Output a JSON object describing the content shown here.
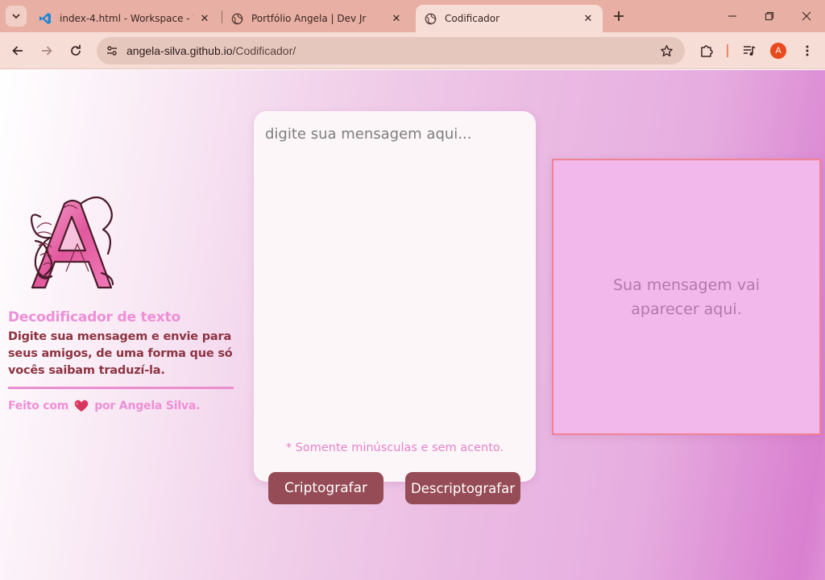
{
  "browser": {
    "tabs": [
      {
        "title": "index-4.html - Workspace - Visual Studio Code",
        "icon": "vscode-icon",
        "active": false
      },
      {
        "title": "Portfólio Angela | Dev Jr",
        "icon": "globe-icon",
        "active": false
      },
      {
        "title": "Codificador",
        "icon": "globe-icon",
        "active": true
      }
    ],
    "url_host": "angela-silva.github.io",
    "url_path": "/Codificador/",
    "profile_initial": "A",
    "colors": {
      "tabbar": "#e8b0a4",
      "toolbar": "#f6ddd6",
      "profile": "#e8491d"
    }
  },
  "page": {
    "brand": {
      "title": "Decodificador de texto",
      "description": "Digite sua mensagem e envie para seus amigos, de uma forma que só vocês saibam traduzí-la.",
      "footer_prefix": "Feito com",
      "footer_suffix": "por Angela Silva."
    },
    "input": {
      "placeholder": "digite sua mensagem aqui...",
      "hint": "* Somente minúsculas e sem acento."
    },
    "buttons": {
      "encrypt": "Criptografar",
      "decrypt": "Descriptografar"
    },
    "output": {
      "placeholder": "Sua mensagem vai aparecer aqui."
    },
    "colors": {
      "accent_pink": "#ee8fd5",
      "dark_rose": "#8d3442",
      "button": "#964c56",
      "output_bg": "#f3b8eb",
      "output_border": "#f08296"
    }
  }
}
